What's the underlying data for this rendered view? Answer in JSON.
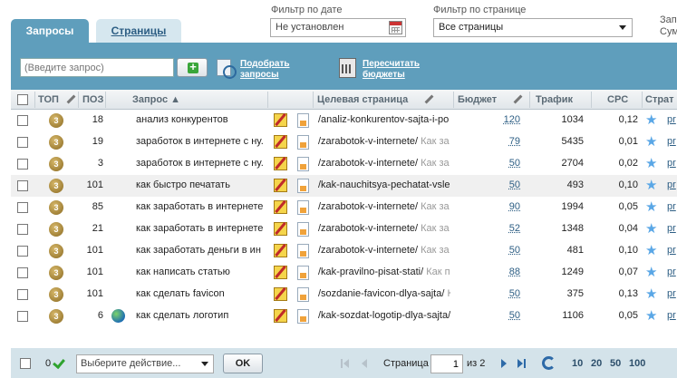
{
  "tabs": [
    {
      "label": "Запросы",
      "active": true
    },
    {
      "label": "Страницы",
      "active": false
    }
  ],
  "filters": {
    "date_label": "Фильтр по дате",
    "date_value": "Не установлен",
    "page_label": "Фильтр по странице",
    "page_value": "Все страницы",
    "cut_label_1": "Зап",
    "cut_label_2": "Сум"
  },
  "toolbar": {
    "query_placeholder": "(Введите запрос)",
    "pick_link_1": "Подобрать",
    "pick_link_2": "запросы",
    "recalc_link_1": "Пересчитать",
    "recalc_link_2": "бюджеты"
  },
  "columns": {
    "top": "ТОП",
    "pos": "ПОЗ",
    "query": "Запрос ▲",
    "target": "Целевая страница",
    "budget": "Бюджет",
    "traffic": "Трафик",
    "cpc": "CPC",
    "strategy": "Страт"
  },
  "rows": [
    {
      "top": "3",
      "pos": "18",
      "globe": false,
      "query": "анализ конкурентов",
      "url": "/analiz-konkurentov-sajta-i-po",
      "title": "",
      "budget": "120",
      "traffic": "1034",
      "cpc": "0,12",
      "strat": "pr"
    },
    {
      "top": "3",
      "pos": "19",
      "globe": false,
      "query": "заработок в интернете с ну.",
      "url": "/zarabotok-v-internete/",
      "title": " Как за",
      "budget": "79",
      "traffic": "5435",
      "cpc": "0,01",
      "strat": "pr"
    },
    {
      "top": "3",
      "pos": "3",
      "globe": false,
      "query": "заработок в интернете с ну.",
      "url": "/zarabotok-v-internete/",
      "title": " Как за",
      "budget": "50",
      "traffic": "2704",
      "cpc": "0,02",
      "strat": "pr"
    },
    {
      "top": "3",
      "pos": "101",
      "globe": false,
      "query": "как быстро печатать",
      "url": "/kak-nauchitsya-pechatat-vsle",
      "title": "",
      "budget": "50",
      "traffic": "493",
      "cpc": "0,10",
      "strat": "pr"
    },
    {
      "top": "3",
      "pos": "85",
      "globe": false,
      "query": "как заработать в интернете",
      "url": "/zarabotok-v-internete/",
      "title": " Как за",
      "budget": "90",
      "traffic": "1994",
      "cpc": "0,05",
      "strat": "pr"
    },
    {
      "top": "3",
      "pos": "21",
      "globe": false,
      "query": "как заработать в интернете",
      "url": "/zarabotok-v-internete/",
      "title": " Как за",
      "budget": "52",
      "traffic": "1348",
      "cpc": "0,04",
      "strat": "pr"
    },
    {
      "top": "3",
      "pos": "101",
      "globe": false,
      "query": "как заработать деньги в ин",
      "url": "/zarabotok-v-internete/",
      "title": " Как за",
      "budget": "50",
      "traffic": "481",
      "cpc": "0,10",
      "strat": "pr"
    },
    {
      "top": "3",
      "pos": "101",
      "globe": false,
      "query": "как написать статью",
      "url": "/kak-pravilno-pisat-stati/",
      "title": " Как п",
      "budget": "88",
      "traffic": "1249",
      "cpc": "0,07",
      "strat": "pr"
    },
    {
      "top": "3",
      "pos": "101",
      "globe": false,
      "query": "как сделать favicon",
      "url": "/sozdanie-favicon-dlya-sajta/",
      "title": " К",
      "budget": "50",
      "traffic": "375",
      "cpc": "0,13",
      "strat": "pr"
    },
    {
      "top": "3",
      "pos": "6",
      "globe": true,
      "query": "как сделать логотип",
      "url": "/kak-sozdat-logotip-dlya-sajta/",
      "title": "",
      "budget": "50",
      "traffic": "1106",
      "cpc": "0,05",
      "strat": "pr"
    }
  ],
  "footer": {
    "selected_count": "0",
    "action_placeholder": "Выберите действие...",
    "ok_label": "OK",
    "page_label": "Страница",
    "page_value": "1",
    "of_label": "из 2",
    "sizes": [
      "10",
      "20",
      "50",
      "100"
    ]
  },
  "colors": {
    "accent": "#5f9ebc",
    "link": "#2d5e84",
    "add_green": "#3aa63a"
  }
}
